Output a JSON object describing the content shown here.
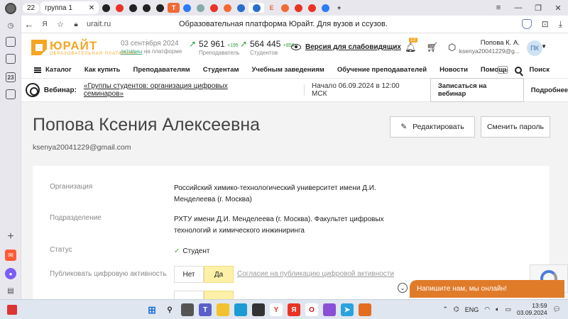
{
  "browser": {
    "tab_count": "22",
    "tab_group": "группа 1",
    "url": "urait.ru",
    "page_title": "Образовательная платформа Юрайт. Для вузов и ссузов."
  },
  "header": {
    "logo_main": "ЮРАЙТ",
    "logo_sub": "ОБРАЗОВАТЕЛЬНАЯ ПЛАТФОРМА",
    "date": "03 сентября 2024",
    "active_prefix": "активны",
    "active_suffix": " на платформе",
    "teachers": {
      "count": "52 961",
      "delta": "+195",
      "label": "Преподаватель"
    },
    "students": {
      "count": "564 445",
      "delta": "+858",
      "label": "Студентов"
    },
    "vision_label": "Версия для слабовидящих",
    "notifications_count": "12",
    "user_name": "Попова К. А.",
    "user_email": "ksenya20041229@g...",
    "user_initials": "ПК"
  },
  "menu": {
    "items": [
      "Каталог",
      "Как купить",
      "Преподавателям",
      "Студентам",
      "Учебным заведениям",
      "Обучение преподавателей",
      "Новости",
      "Помощь"
    ],
    "search_label": "Поиск"
  },
  "webinar": {
    "label": "Вебинар:",
    "title": "«Группы студентов: организация цифровых семинаров»",
    "start": "Начало 06.09.2024 в 12:00 МСК",
    "register_label": "Записаться на вебинар",
    "more_label": "Подробнее"
  },
  "profile": {
    "name": "Попова Ксения Алексеевна",
    "email": "ksenya20041229@gmail.com",
    "edit_label": "Редактировать",
    "change_password_label": "Сменить пароль",
    "fields": [
      {
        "key": "Организация",
        "value": "Российский химико-технологический университет имени Д.И. Менделеева (г. Москва)"
      },
      {
        "key": "Подразделение",
        "value": "РХТУ имени Д.И. Менделеева (г. Москва). Факультет цифровых технологий и химического инжиниринга"
      },
      {
        "key": "Статус",
        "value": "Студент"
      },
      {
        "key": "Публиковать цифровую активность",
        "no": "Нет",
        "yes": "Да",
        "consent": "Согласие на публикацию цифровой активности"
      }
    ]
  },
  "chat": {
    "label": "Напишите нам, мы онлайн!"
  },
  "taskbar": {
    "lang": "ENG",
    "time": "13:59",
    "date": "03.09.2024"
  }
}
